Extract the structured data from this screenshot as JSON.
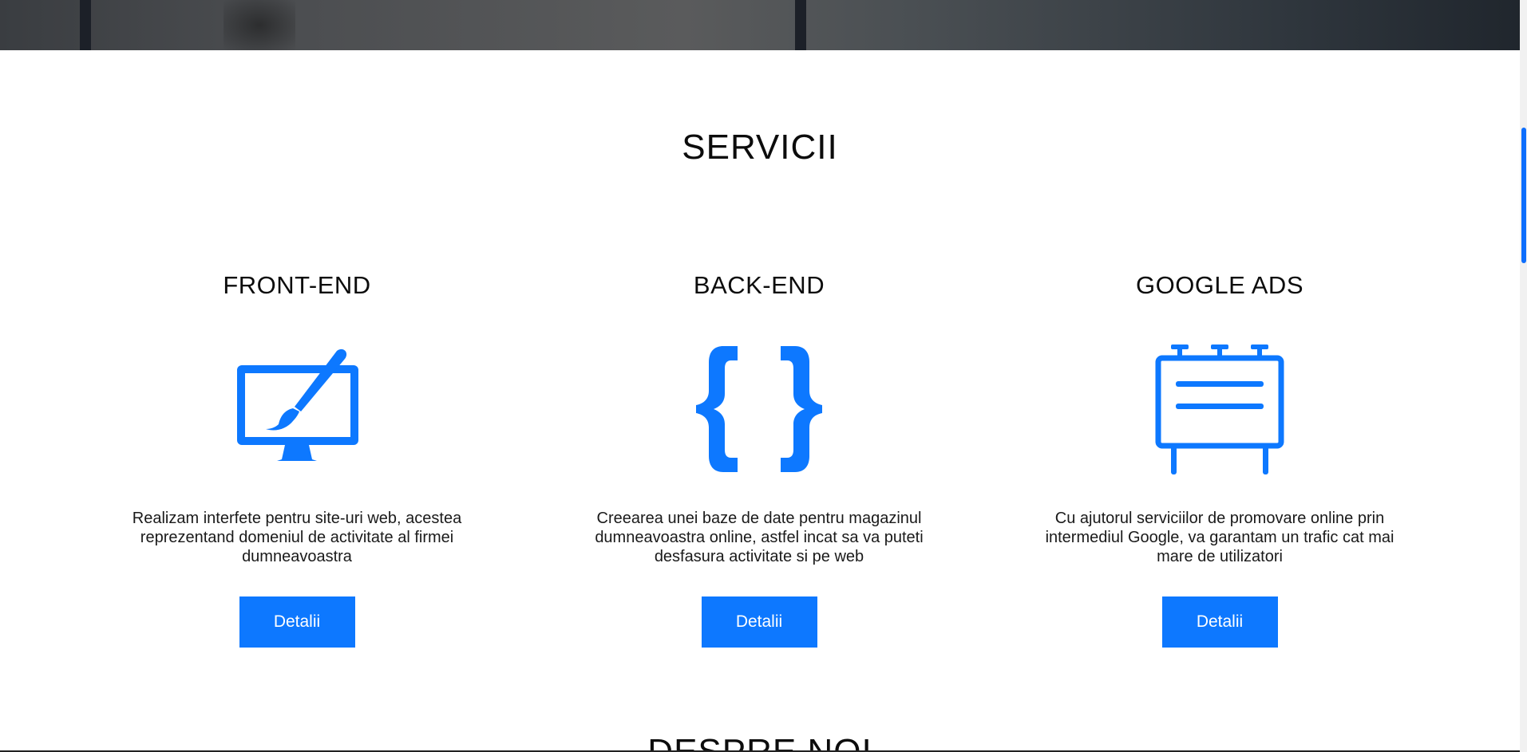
{
  "hero": {
    "kind": "photo-strip"
  },
  "section": {
    "title": "SERVICII"
  },
  "services": [
    {
      "title": "FRONT-END",
      "icon": "monitor-brush-icon",
      "description": "Realizam interfete pentru site-uri web, acestea reprezentand domeniul de activitate al firmei dumneavoastra",
      "button_label": "Detalii"
    },
    {
      "title": "BACK-END",
      "icon": "curly-braces-icon",
      "description": "Creearea unei baze de date pentru magazinul dumneavoastra online, astfel incat sa va puteti desfasura activitate si pe web",
      "button_label": "Detalii"
    },
    {
      "title": "GOOGLE ADS",
      "icon": "billboard-icon",
      "description": "Cu ajutorul serviciilor de promovare online prin intermediul Google, va garantam un trafic cat mai mare de utilizatori",
      "button_label": "Detalii"
    }
  ],
  "next_section": {
    "title": "DESPRE NOI"
  },
  "colors": {
    "accent": "#0d78ff",
    "text": "#0c0c0c",
    "background": "#ffffff"
  }
}
